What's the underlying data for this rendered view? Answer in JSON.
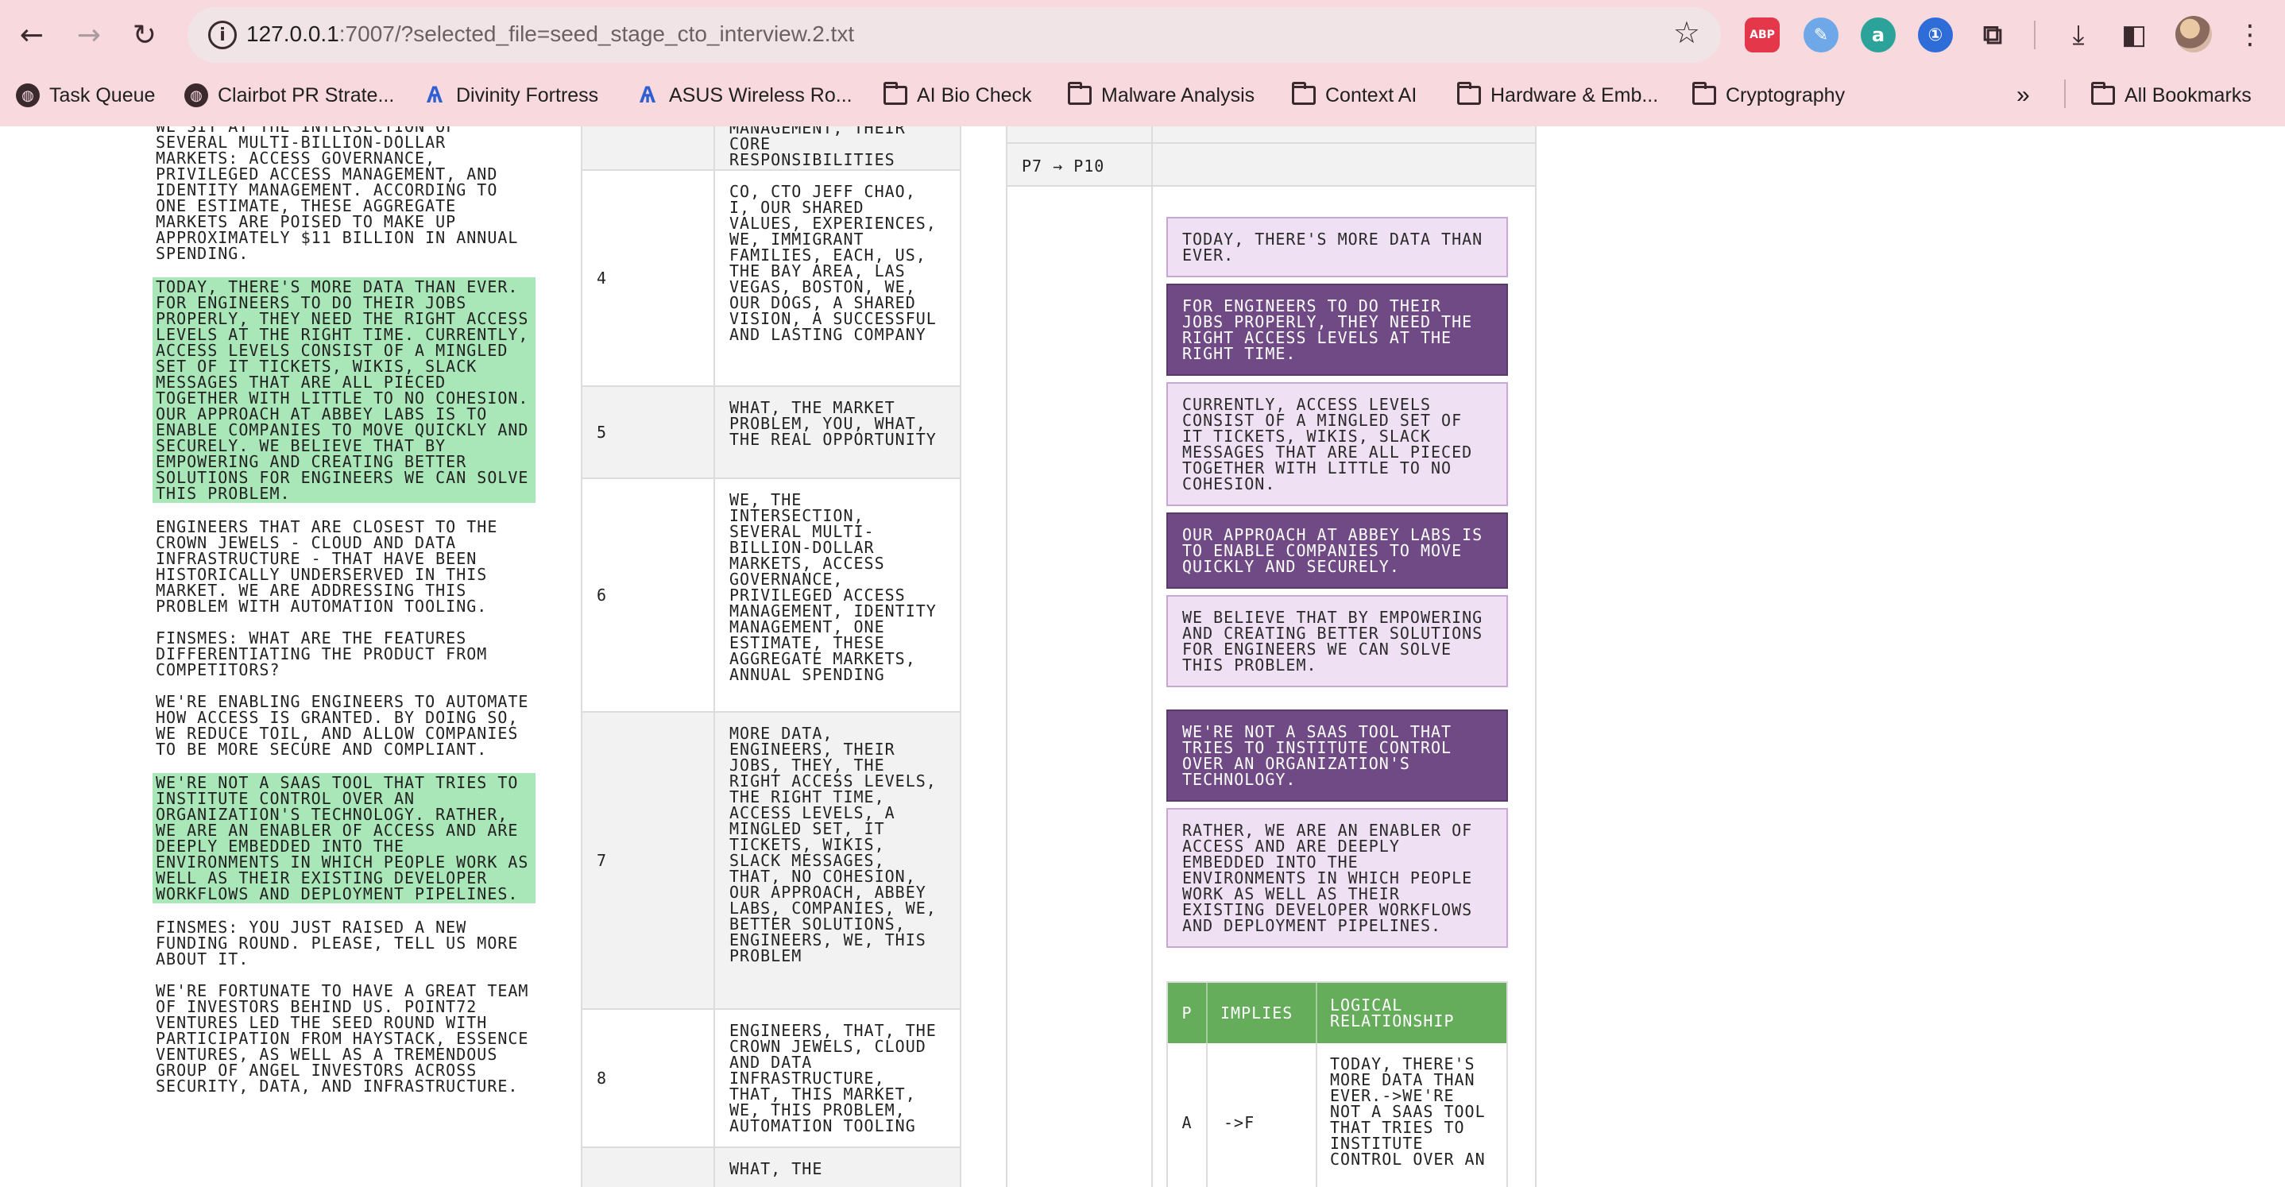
{
  "browser": {
    "url_host": "127.0.0.1",
    "url_rest": ":7007/?selected_file=seed_stage_cto_interview.2.txt",
    "extensions": {
      "abp": "ABP",
      "pen": "✎",
      "amazon": "a",
      "password": "①"
    },
    "bookmarks": [
      {
        "label": "Task Queue",
        "icon": "globe-icon"
      },
      {
        "label": "Clairbot PR Strate...",
        "icon": "globe-icon"
      },
      {
        "label": "Divinity Fortress",
        "icon": "dragonfly-icon"
      },
      {
        "label": "ASUS Wireless Ro...",
        "icon": "dragonfly-icon"
      },
      {
        "label": "AI Bio Check",
        "icon": "folder-icon"
      },
      {
        "label": "Malware Analysis",
        "icon": "folder-icon"
      },
      {
        "label": "Context AI",
        "icon": "folder-icon"
      },
      {
        "label": "Hardware & Emb...",
        "icon": "folder-icon"
      },
      {
        "label": "Cryptography",
        "icon": "folder-icon"
      }
    ],
    "overflow": "»",
    "all_bookmarks": "All Bookmarks"
  },
  "document": {
    "paragraphs": [
      {
        "text": "We sit at the intersection of several multi-billion-dollar markets: access governance, privileged access management, and identity management. According to one estimate, these aggregate markets are poised to make up approximately $11 billion in annual spending.",
        "highlight": false
      },
      {
        "text": "Today, there's more data than ever. For engineers to do their jobs properly, they need the right access levels at the right time. Currently, access levels consist of a mingled set of IT tickets, wikis, Slack messages that are all pieced together with little to no cohesion. Our approach at Abbey Labs is to enable companies to move quickly and securely. We believe that by empowering and creating better solutions for engineers we can solve this problem.",
        "highlight": true
      },
      {
        "text": "Engineers that are closest to the crown jewels - cloud and data infrastructure - that have been historically underserved in this market. We are addressing this problem with automation tooling.",
        "highlight": false
      },
      {
        "text": "FinSMEs: What are the features differentiating the product from competitors?",
        "highlight": false
      },
      {
        "text": "We're enabling engineers to automate how access is granted. By doing so, we reduce toil, and allow companies to be more secure and compliant.",
        "highlight": false
      },
      {
        "text": "We're not a SaaS tool that tries to institute control over an organization's technology. Rather, we are an enabler of access and are deeply embedded into the environments in which people work as well as their existing developer workflows and deployment pipelines.",
        "highlight": true
      },
      {
        "text": "FinSMEs: You just raised a new funding round. Please, tell us more about it.",
        "highlight": false
      },
      {
        "text": "We're fortunate to have a great team of investors behind us. Point72 Ventures led the seed round with participation from Haystack, Essence Ventures, as well as a tremendous group of angel investors across security, data, and infrastructure.",
        "highlight": false
      }
    ]
  },
  "keywords_table": {
    "top_text": "management, their core responsibilities",
    "rows": [
      {
        "n": "4",
        "text": "Co, CTO Jeff Chao, I, our shared values, experiences, we, immigrant families, each, us, the Bay Area, Las Vegas, Boston, we, our dogs, a shared vision, a successful and lasting company"
      },
      {
        "n": "5",
        "text": "what, the market problem, you, what, the real opportunity"
      },
      {
        "n": "6",
        "text": "We, the intersection, several multi-billion-dollar markets, access governance, privileged access management, identity management, one estimate, these aggregate markets, annual spending"
      },
      {
        "n": "7",
        "text": "more data, engineers, their jobs, they, the right access levels, the right time, access levels, a mingled set, IT tickets, wikis, Slack messages, that, no cohesion, Our approach, Abbey Labs, companies, We, better solutions, engineers, we, this problem"
      },
      {
        "n": "8",
        "text": "Engineers, that, the crown jewels, cloud and data infrastructure, that, this market, We, this problem, automation tooling"
      },
      {
        "n": "",
        "text": "What, the"
      }
    ]
  },
  "logic_panel": {
    "top_partial": "P7 → P10",
    "header_label": "P7 → P10",
    "sentences": [
      {
        "text": "Today, there's more data than ever.",
        "style": "light"
      },
      {
        "text": "For engineers to do their jobs properly, they need the right access levels at the right time.",
        "style": "dark"
      },
      {
        "text": "Currently, access levels consist of a mingled set of IT tickets, wikis, Slack messages that are all pieced together with little to no cohesion.",
        "style": "light"
      },
      {
        "text": "Our approach at Abbey Labs is to enable companies to move quickly and securely.",
        "style": "dark"
      },
      {
        "text": "We believe that by empowering and creating better solutions for engineers we can solve this problem.",
        "style": "light"
      },
      {
        "text": "We're not a SaaS tool that tries to institute control over an organization's technology.",
        "style": "dark"
      },
      {
        "text": "Rather, we are an enabler of access and are deeply embedded into the environments in which people work as well as their existing developer workflows and deployment pipelines.",
        "style": "light"
      }
    ],
    "table": {
      "headers": [
        "P",
        "Implies",
        "Logical Relationship"
      ],
      "rows": [
        {
          "p": "A",
          "implies": "->F",
          "relationship": "Today, there's more data than ever.->We're not a SaaS tool that tries to institute control over an"
        }
      ]
    }
  }
}
